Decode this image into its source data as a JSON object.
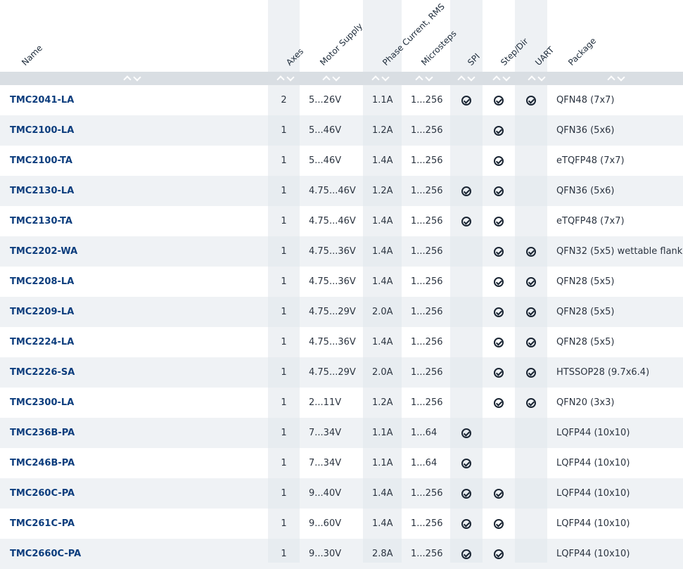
{
  "columns": [
    {
      "key": "name",
      "label": "Name"
    },
    {
      "key": "axes",
      "label": "Axes"
    },
    {
      "key": "supply",
      "label": "Motor Supply"
    },
    {
      "key": "current",
      "label": "Phase Current, RMS"
    },
    {
      "key": "micro",
      "label": "Microsteps"
    },
    {
      "key": "spi",
      "label": "SPI"
    },
    {
      "key": "step",
      "label": "Step/Dir"
    },
    {
      "key": "uart",
      "label": "UART"
    },
    {
      "key": "pkg",
      "label": "Package"
    }
  ],
  "rows": [
    {
      "name": "TMC2041-LA",
      "axes": "2",
      "supply": "5...26V",
      "current": "1.1A",
      "micro": "1...256",
      "spi": true,
      "step": true,
      "uart": true,
      "pkg": "QFN48 (7x7)"
    },
    {
      "name": "TMC2100-LA",
      "axes": "1",
      "supply": "5...46V",
      "current": "1.2A",
      "micro": "1...256",
      "spi": false,
      "step": true,
      "uart": false,
      "pkg": "QFN36 (5x6)"
    },
    {
      "name": "TMC2100-TA",
      "axes": "1",
      "supply": "5...46V",
      "current": "1.4A",
      "micro": "1...256",
      "spi": false,
      "step": true,
      "uart": false,
      "pkg": "eTQFP48 (7x7)"
    },
    {
      "name": "TMC2130-LA",
      "axes": "1",
      "supply": "4.75...46V",
      "current": "1.2A",
      "micro": "1...256",
      "spi": true,
      "step": true,
      "uart": false,
      "pkg": "QFN36 (5x6)"
    },
    {
      "name": "TMC2130-TA",
      "axes": "1",
      "supply": "4.75...46V",
      "current": "1.4A",
      "micro": "1...256",
      "spi": true,
      "step": true,
      "uart": false,
      "pkg": "eTQFP48 (7x7)"
    },
    {
      "name": "TMC2202-WA",
      "axes": "1",
      "supply": "4.75...36V",
      "current": "1.4A",
      "micro": "1...256",
      "spi": false,
      "step": true,
      "uart": true,
      "pkg": "QFN32 (5x5) wettable flank"
    },
    {
      "name": "TMC2208-LA",
      "axes": "1",
      "supply": "4.75...36V",
      "current": "1.4A",
      "micro": "1...256",
      "spi": false,
      "step": true,
      "uart": true,
      "pkg": "QFN28 (5x5)"
    },
    {
      "name": "TMC2209-LA",
      "axes": "1",
      "supply": "4.75...29V",
      "current": "2.0A",
      "micro": "1...256",
      "spi": false,
      "step": true,
      "uart": true,
      "pkg": "QFN28 (5x5)"
    },
    {
      "name": "TMC2224-LA",
      "axes": "1",
      "supply": "4.75...36V",
      "current": "1.4A",
      "micro": "1...256",
      "spi": false,
      "step": true,
      "uart": true,
      "pkg": "QFN28 (5x5)"
    },
    {
      "name": "TMC2226-SA",
      "axes": "1",
      "supply": "4.75...29V",
      "current": "2.0A",
      "micro": "1...256",
      "spi": false,
      "step": true,
      "uart": true,
      "pkg": "HTSSOP28 (9.7x6.4)"
    },
    {
      "name": "TMC2300-LA",
      "axes": "1",
      "supply": "2...11V",
      "current": "1.2A",
      "micro": "1...256",
      "spi": false,
      "step": true,
      "uart": true,
      "pkg": "QFN20 (3x3)"
    },
    {
      "name": "TMC236B-PA",
      "axes": "1",
      "supply": "7...34V",
      "current": "1.1A",
      "micro": "1...64",
      "spi": true,
      "step": false,
      "uart": false,
      "pkg": "LQFP44 (10x10)"
    },
    {
      "name": "TMC246B-PA",
      "axes": "1",
      "supply": "7...34V",
      "current": "1.1A",
      "micro": "1...64",
      "spi": true,
      "step": false,
      "uart": false,
      "pkg": "LQFP44 (10x10)"
    },
    {
      "name": "TMC260C-PA",
      "axes": "1",
      "supply": "9...40V",
      "current": "1.4A",
      "micro": "1...256",
      "spi": true,
      "step": true,
      "uart": false,
      "pkg": "LQFP44 (10x10)"
    },
    {
      "name": "TMC261C-PA",
      "axes": "1",
      "supply": "9...60V",
      "current": "1.4A",
      "micro": "1...256",
      "spi": true,
      "step": true,
      "uart": false,
      "pkg": "LQFP44 (10x10)"
    },
    {
      "name": "TMC2660C-PA",
      "axes": "1",
      "supply": "9...30V",
      "current": "2.8A",
      "micro": "1...256",
      "spi": true,
      "step": true,
      "uart": false,
      "pkg": "LQFP44 (10x10)"
    }
  ]
}
